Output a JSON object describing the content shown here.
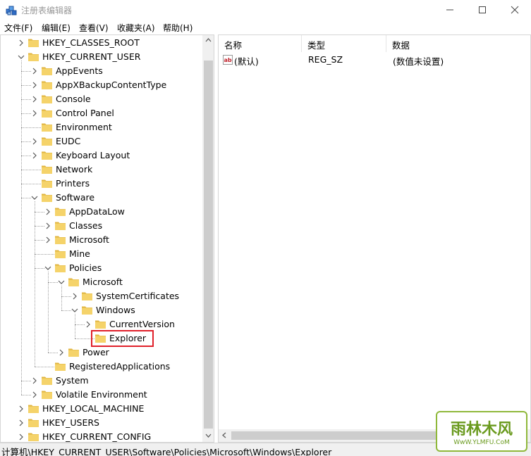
{
  "window": {
    "title": "注册表编辑器"
  },
  "menu": [
    "文件(F)",
    "编辑(E)",
    "查看(V)",
    "收藏夹(A)",
    "帮助(H)"
  ],
  "tree": [
    {
      "label": "HKEY_CLASSES_ROOT",
      "depth": 0,
      "state": "collapsed"
    },
    {
      "label": "HKEY_CURRENT_USER",
      "depth": 0,
      "state": "expanded"
    },
    {
      "label": "AppEvents",
      "depth": 1,
      "state": "collapsed"
    },
    {
      "label": "AppXBackupContentType",
      "depth": 1,
      "state": "collapsed"
    },
    {
      "label": "Console",
      "depth": 1,
      "state": "collapsed"
    },
    {
      "label": "Control Panel",
      "depth": 1,
      "state": "collapsed"
    },
    {
      "label": "Environment",
      "depth": 1,
      "state": "leaf"
    },
    {
      "label": "EUDC",
      "depth": 1,
      "state": "collapsed"
    },
    {
      "label": "Keyboard Layout",
      "depth": 1,
      "state": "collapsed"
    },
    {
      "label": "Network",
      "depth": 1,
      "state": "leaf"
    },
    {
      "label": "Printers",
      "depth": 1,
      "state": "leaf"
    },
    {
      "label": "Software",
      "depth": 1,
      "state": "expanded"
    },
    {
      "label": "AppDataLow",
      "depth": 2,
      "state": "collapsed"
    },
    {
      "label": "Classes",
      "depth": 2,
      "state": "collapsed"
    },
    {
      "label": "Microsoft",
      "depth": 2,
      "state": "collapsed"
    },
    {
      "label": "Mine",
      "depth": 2,
      "state": "leaf"
    },
    {
      "label": "Policies",
      "depth": 2,
      "state": "expanded"
    },
    {
      "label": "Microsoft",
      "depth": 3,
      "state": "expanded"
    },
    {
      "label": "SystemCertificates",
      "depth": 4,
      "state": "collapsed"
    },
    {
      "label": "Windows",
      "depth": 4,
      "state": "expanded"
    },
    {
      "label": "CurrentVersion",
      "depth": 5,
      "state": "collapsed"
    },
    {
      "label": "Explorer",
      "depth": 5,
      "state": "leaf",
      "selected": true
    },
    {
      "label": "Power",
      "depth": 3,
      "state": "collapsed"
    },
    {
      "label": "RegisteredApplications",
      "depth": 2,
      "state": "leaf"
    },
    {
      "label": "System",
      "depth": 1,
      "state": "collapsed"
    },
    {
      "label": "Volatile Environment",
      "depth": 1,
      "state": "collapsed"
    },
    {
      "label": "HKEY_LOCAL_MACHINE",
      "depth": 0,
      "state": "collapsed"
    },
    {
      "label": "HKEY_USERS",
      "depth": 0,
      "state": "collapsed"
    },
    {
      "label": "HKEY_CURRENT_CONFIG",
      "depth": 0,
      "state": "collapsed"
    }
  ],
  "list": {
    "columns": [
      "名称",
      "类型",
      "数据"
    ],
    "rows": [
      {
        "icon": "string-value-icon",
        "name": "(默认)",
        "type": "REG_SZ",
        "data": "(数值未设置)"
      }
    ]
  },
  "status": {
    "path": "计算机\\HKEY_CURRENT_USER\\Software\\Policies\\Microsoft\\Windows\\Explorer"
  },
  "watermark": {
    "main": "雨林木风",
    "url": "WwW.YLMFU.CoM"
  },
  "colors": {
    "folder": "#f5d36a",
    "folder_dark": "#e0b440",
    "selection_box": "#e0202a",
    "watermark": "#6a9a1e"
  }
}
